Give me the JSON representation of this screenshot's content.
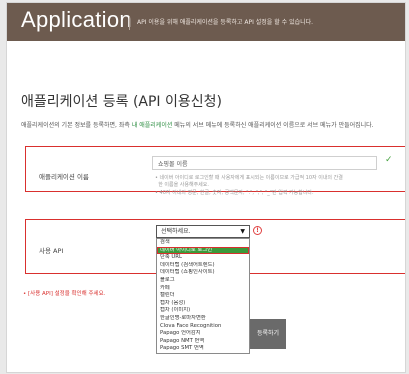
{
  "header": {
    "title": "Application",
    "description": "API 이용을 위해 애플리케이션을 등록하고 API 설정을 할 수 있습니다."
  },
  "page": {
    "title": "애플리케이션 등록 (API 이용신청)",
    "description_start": "애플리케이션의 기본 정보를 등록하면, 좌측 ",
    "description_link": "내 애플리케이션",
    "description_end": " 메뉴의 서브 메뉴에 등록하신 애플리케이션 이름으로 서브 메뉴가 만들어집니다."
  },
  "app_name": {
    "label": "애플리케이션 이름",
    "value": "쇼핑몰 이름",
    "hint1": "네이버 아이디로 로그인할 때 사용자에게 표시되는 이름이므로 가급적 10자 이내의 간결",
    "hint1b": "한 이름을 사용해주세요.",
    "hint2": "40자 이내의 영문, 한글, 숫자, 공백문자, \".\", \",\", \"_\"만 입력 가능합니다."
  },
  "api": {
    "label": "사용 API",
    "selected": "선택하세요.",
    "options": [
      "검색",
      "네이버 아이디로 로그인",
      "단축 URL",
      "데이터랩 (검색어트렌드)",
      "데이터랩 (쇼핑인사이트)",
      "블로그",
      "카페",
      "캘린더",
      "캡차 (음성)",
      "캡차 (이미지)",
      "한글인명-로마자변환",
      "Clova Face Recognition",
      "Papago 언어감지",
      "Papago NMT 번역",
      "Papago SMT 번역"
    ],
    "highlighted_index": 1
  },
  "footer_note": "• [사용 API] 설정을 확인해 주세요.",
  "submit_label": "등록하기",
  "colors": {
    "header_bg": "#6d5b4f",
    "accent_red": "#d9302e",
    "selected_green": "#3b9a3b"
  }
}
